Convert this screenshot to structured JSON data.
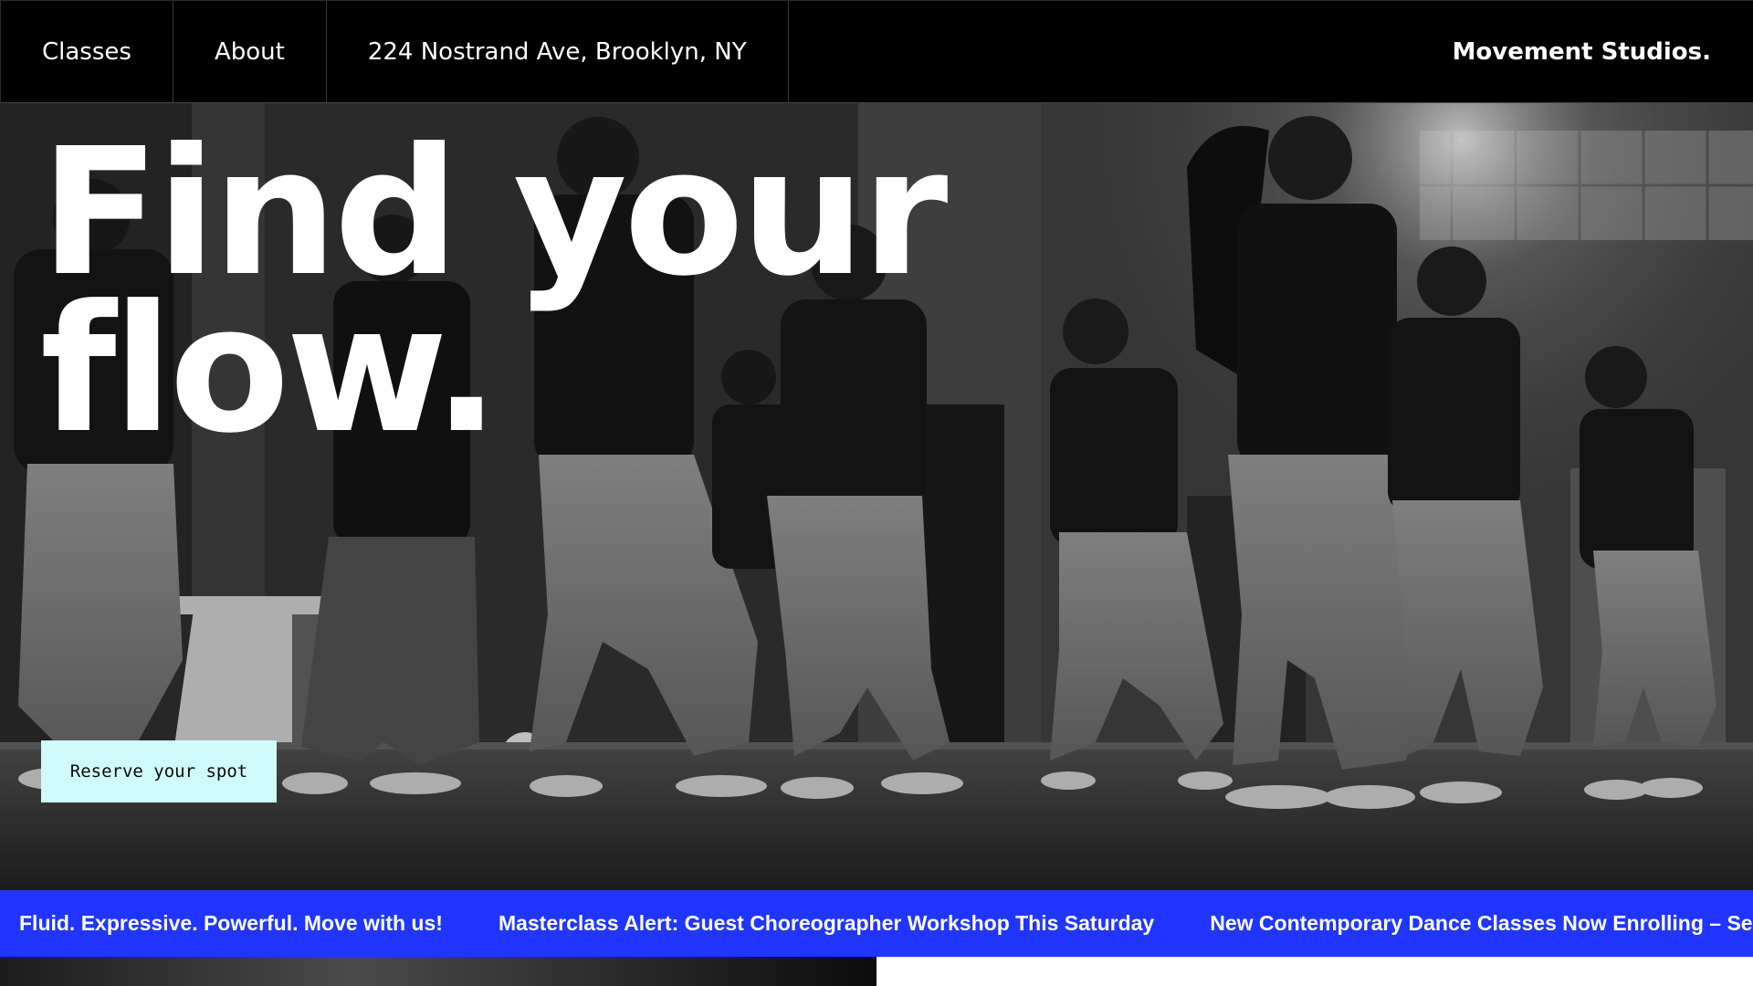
{
  "nav": {
    "items": [
      {
        "label": "Classes"
      },
      {
        "label": "About"
      },
      {
        "label": "224 Nostrand Ave, Brooklyn, NY"
      }
    ],
    "brand": "Movement Studios."
  },
  "hero": {
    "title": "Find your\nflow.",
    "cta_label": "Reserve your spot",
    "image_icon": "dance-class-photo"
  },
  "ticker": {
    "items": [
      "Fluid. Expressive. Powerful. Move with us!",
      "Masterclass Alert: Guest Choreographer Workshop This Saturday",
      "New Contemporary Dance Classes Now Enrolling – Secure Your Spot"
    ],
    "color": "#2035ff"
  },
  "colors": {
    "nav_bg": "#000000",
    "cta_bg": "#cffbfb",
    "ticker_bg": "#2035ff"
  }
}
